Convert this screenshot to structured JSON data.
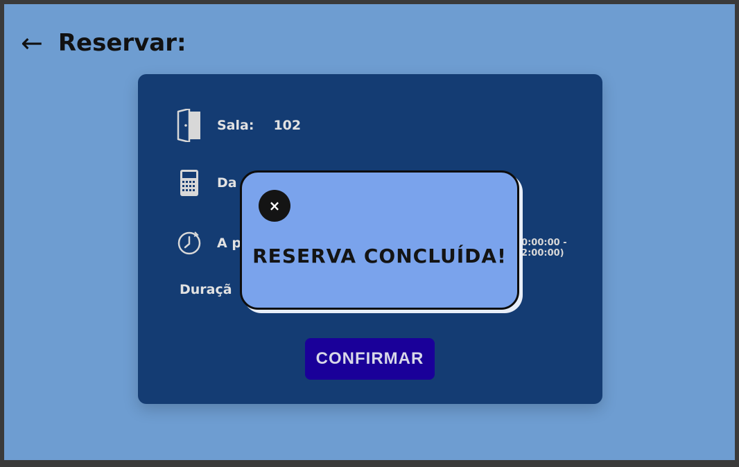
{
  "header": {
    "back_icon": "left-arrow-icon",
    "back_glyph": "←",
    "title": "Reservar:"
  },
  "form": {
    "sala": {
      "icon": "door-icon",
      "label": "Sala:",
      "value": "102"
    },
    "data": {
      "icon": "calculator-icon",
      "label_visible": "Da"
    },
    "a_partir": {
      "icon": "clock-icon",
      "label_visible": "A p",
      "slot_note": "10:00:00 - 12:00:00)"
    },
    "duracao": {
      "label_visible": "Duraçã"
    },
    "confirm_label": "CONFIRMAR"
  },
  "modal": {
    "close_glyph": "×",
    "message": "RESERVA CONCLUÍDA!"
  },
  "colors": {
    "background": "#6e9dd1",
    "card": "#143c73",
    "confirm_button": "#1a0099",
    "modal": "#7aa3ec"
  }
}
